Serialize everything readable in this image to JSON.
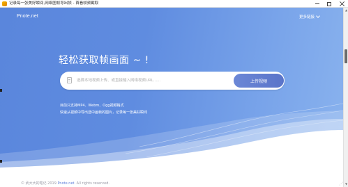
{
  "window": {
    "title": "记录每一张美好瞬间,网络图帧导出帧 - 首看帧频截取"
  },
  "header": {
    "logo": "Pnote.net",
    "more_links": "更多链接"
  },
  "hero": {
    "headline": "轻松获取帧画面 ~ !",
    "search_placeholder": "选择本地视频上传、或直接输入网络视频URL......",
    "upload_label": "上传视频",
    "hint_formats": "目前只支持MP4、Webm、Ogg视频格式",
    "hint_desc": "快速从视频中导出选中画帧的图片，记录每一张美好瞬间"
  },
  "footer": {
    "copyright_prefix": "© 武大大的笔记 2019 ",
    "site_link": "Pnote.net",
    "rights": ". All rights reserved."
  },
  "colors": {
    "hero_blue": "#5f8ce0",
    "button_blue": "#5a74c9",
    "link_blue": "#5e7ed9"
  },
  "icons": [
    "app-icon",
    "file-icon",
    "chevron-down-icon",
    "minimize-icon",
    "maximize-icon",
    "close-icon"
  ]
}
